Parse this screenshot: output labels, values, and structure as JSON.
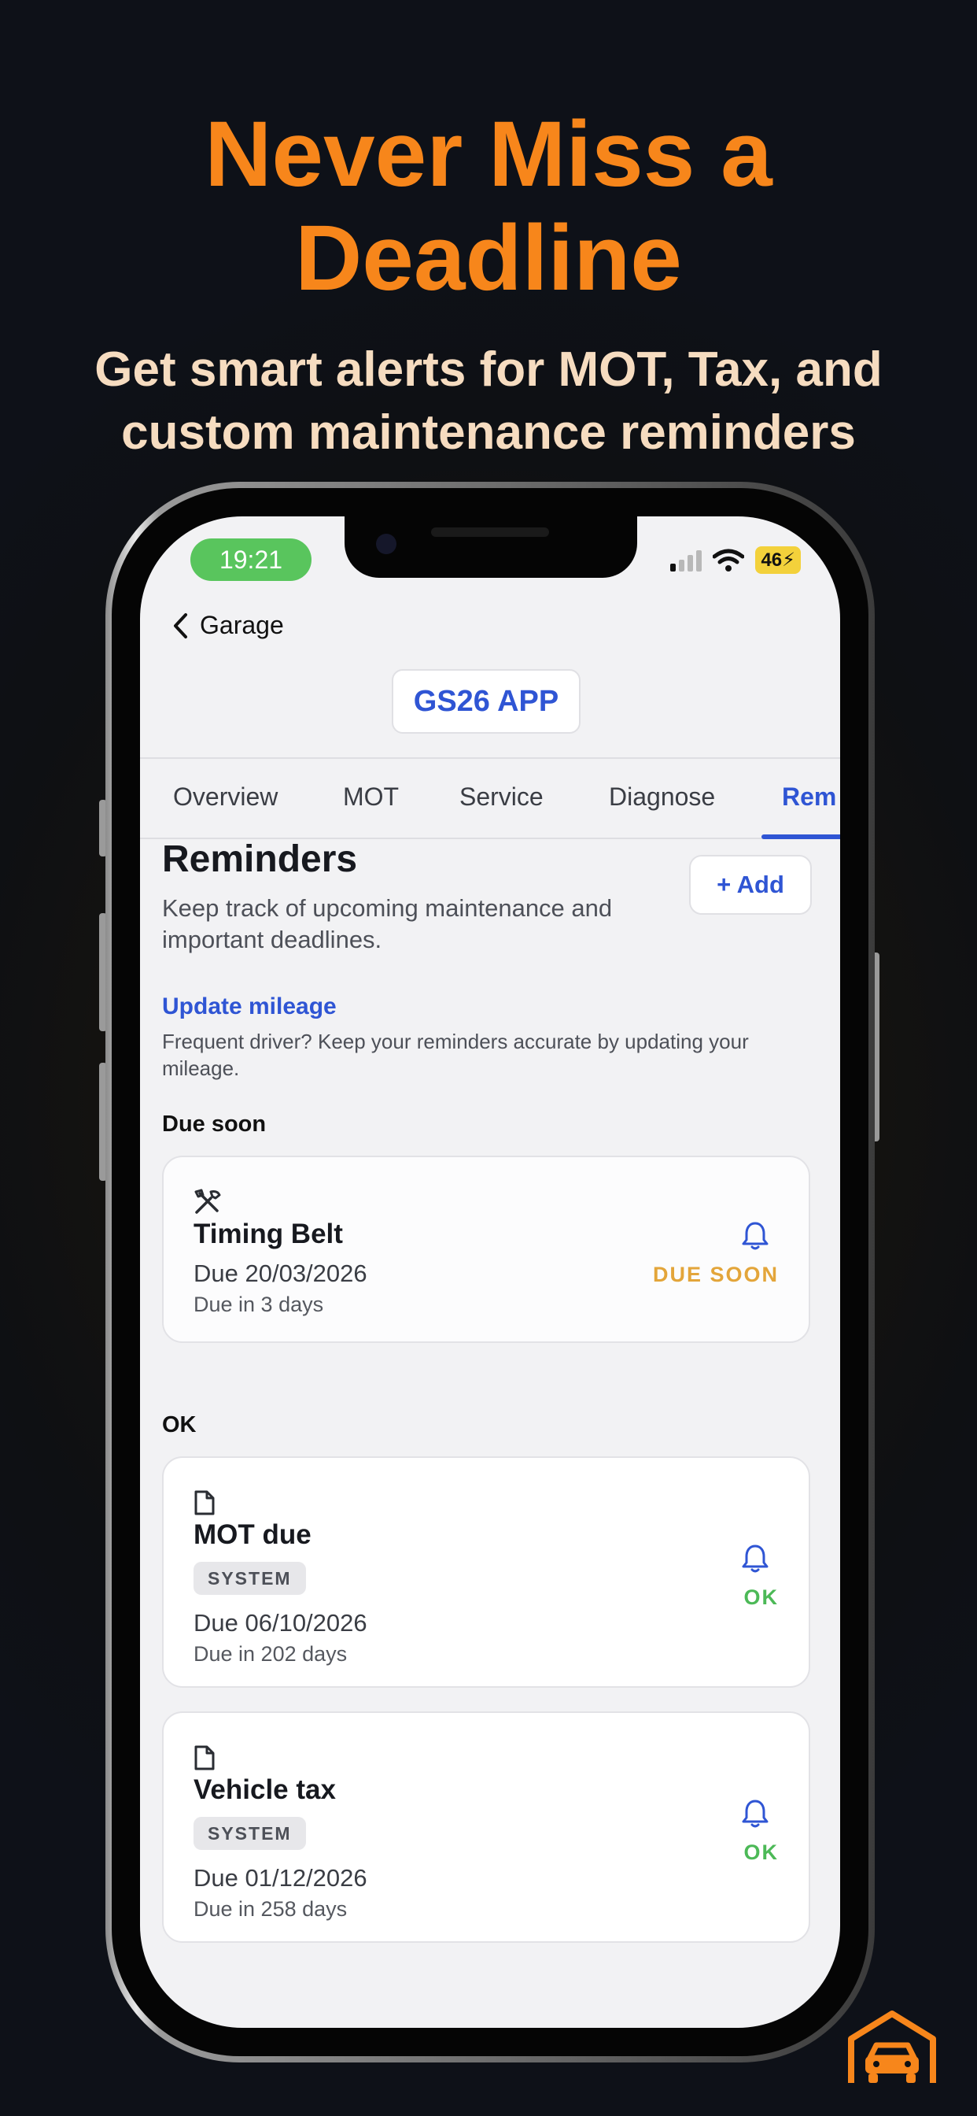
{
  "headline": "Never Miss a Deadline",
  "subheadline": "Get smart alerts for MOT, Tax, and custom maintenance reminders",
  "status_bar": {
    "time": "19:21",
    "battery": "46"
  },
  "nav": {
    "back_label": "Garage",
    "app_title": "GS26 APP"
  },
  "tabs": [
    {
      "label": "Overview"
    },
    {
      "label": "MOT"
    },
    {
      "label": "Service"
    },
    {
      "label": "Diagnose"
    },
    {
      "label": "Rem"
    }
  ],
  "page": {
    "title": "Reminders",
    "description": "Keep track of upcoming maintenance and important deadlines.",
    "add_button": "+ Add",
    "mileage_link": "Update mileage",
    "mileage_desc": "Frequent driver? Keep your reminders accurate by updating your mileage."
  },
  "sections": {
    "due_soon": "Due soon",
    "ok": "OK"
  },
  "reminders": [
    {
      "title": "Timing Belt",
      "due": "Due 20/03/2026",
      "days": "Due in 3 days",
      "status": "DUE SOON",
      "icon": "tools-icon"
    },
    {
      "title": "MOT due",
      "badge": "SYSTEM",
      "due": "Due 06/10/2026",
      "days": "Due in 202 days",
      "status": "OK",
      "icon": "document-icon"
    },
    {
      "title": "Vehicle tax",
      "badge": "SYSTEM",
      "due": "Due 01/12/2026",
      "days": "Due in 258 days",
      "status": "OK",
      "icon": "document-icon"
    }
  ],
  "colors": {
    "accent": "#f7861b",
    "link": "#2f55d4",
    "due_soon": "#e3a53a",
    "ok": "#4cb957"
  }
}
